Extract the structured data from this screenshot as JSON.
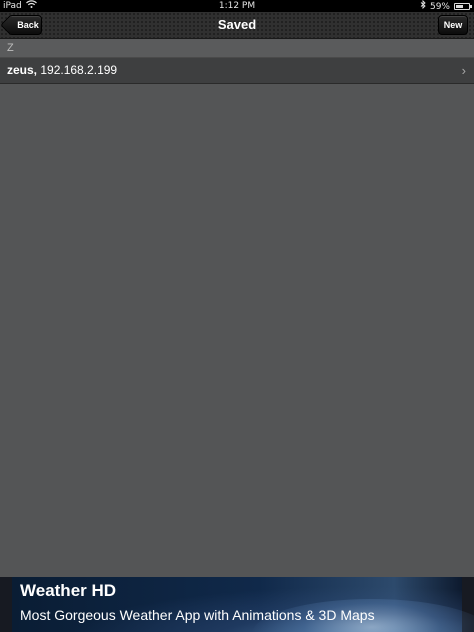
{
  "status_bar": {
    "device": "iPad",
    "time": "1:12 PM",
    "battery_percent": "59%",
    "battery_level": 0.59
  },
  "nav_bar": {
    "title": "Saved",
    "back_label": "Back",
    "new_label": "New"
  },
  "sections": [
    {
      "header": "Z",
      "rows": [
        {
          "name": "zeus,",
          "address": " 192.168.2.199"
        }
      ]
    }
  ],
  "ad": {
    "title": "Weather HD",
    "subtitle": "Most Gorgeous Weather App with  Animations & 3D Maps"
  }
}
